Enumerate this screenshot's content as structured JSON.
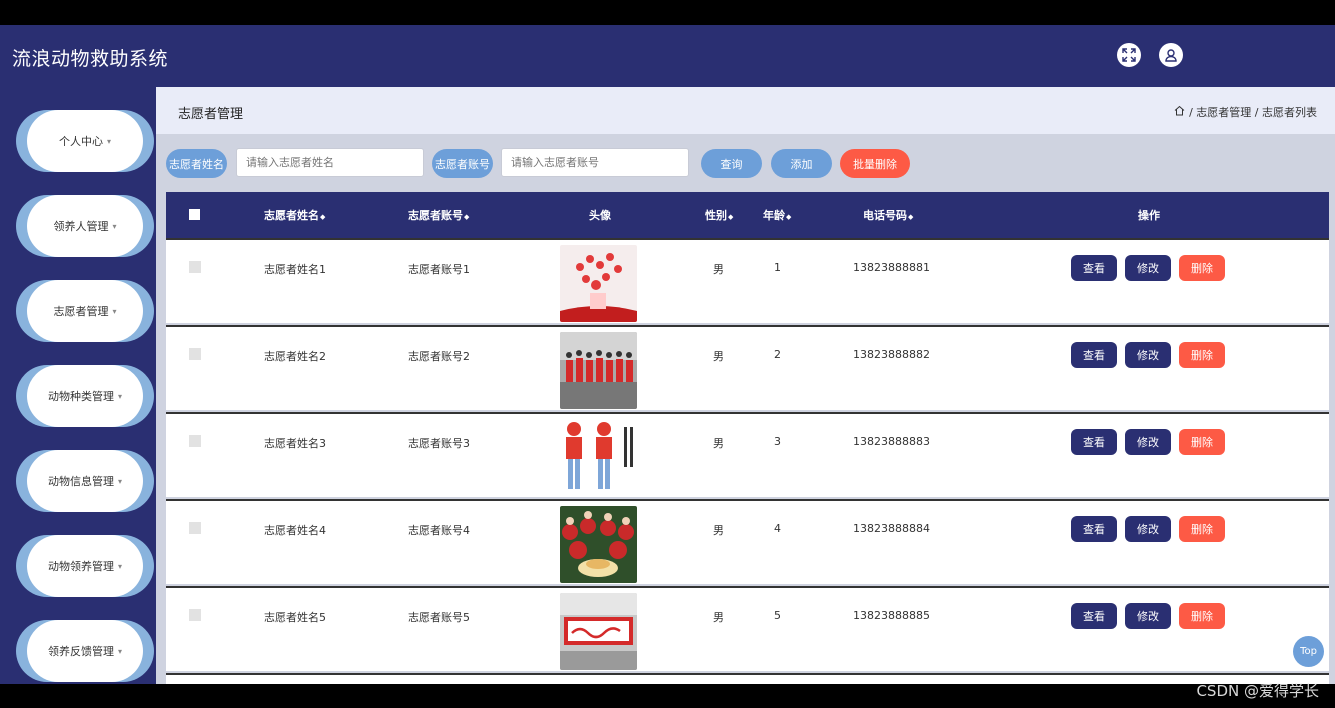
{
  "app": {
    "title": "流浪动物救助系统"
  },
  "header": {
    "fullscreen_icon": "expand-icon",
    "user_icon": "user-icon"
  },
  "sidebar": {
    "items": [
      {
        "label": "个人中心"
      },
      {
        "label": "领养人管理"
      },
      {
        "label": "志愿者管理"
      },
      {
        "label": "动物种类管理"
      },
      {
        "label": "动物信息管理"
      },
      {
        "label": "动物领养管理"
      },
      {
        "label": "领养反馈管理"
      }
    ],
    "caret": "▾"
  },
  "breadcrumb": {
    "title": "志愿者管理",
    "home_icon": "home-icon",
    "path": "/ 志愿者管理 / 志愿者列表"
  },
  "search": {
    "name_label": "志愿者姓名",
    "name_placeholder": "请输入志愿者姓名",
    "account_label": "志愿者账号",
    "account_placeholder": "请输入志愿者账号",
    "query_btn": "查询",
    "add_btn": "添加",
    "batch_delete_btn": "批量删除"
  },
  "table": {
    "columns": {
      "name": "志愿者姓名",
      "account": "志愿者账号",
      "avatar": "头像",
      "gender": "性别",
      "age": "年龄",
      "phone": "电话号码",
      "ops": "操作"
    },
    "sort_icon": "◆",
    "rows": [
      {
        "name": "志愿者姓名1",
        "account": "志愿者账号1",
        "gender": "男",
        "age": "1",
        "phone": "13823888881"
      },
      {
        "name": "志愿者姓名2",
        "account": "志愿者账号2",
        "gender": "男",
        "age": "2",
        "phone": "13823888882"
      },
      {
        "name": "志愿者姓名3",
        "account": "志愿者账号3",
        "gender": "男",
        "age": "3",
        "phone": "13823888883"
      },
      {
        "name": "志愿者姓名4",
        "account": "志愿者账号4",
        "gender": "男",
        "age": "4",
        "phone": "13823888884"
      },
      {
        "name": "志愿者姓名5",
        "account": "志愿者账号5",
        "gender": "男",
        "age": "5",
        "phone": "13823888885"
      }
    ],
    "actions": {
      "view": "查看",
      "edit": "修改",
      "delete": "删除"
    }
  },
  "top_button": "Top",
  "watermark": "CSDN @爱得学长",
  "colors": {
    "primary": "#2a2f72",
    "accent": "#6d9fd9",
    "danger": "#fd5a45",
    "edit": "#2a2f72"
  }
}
